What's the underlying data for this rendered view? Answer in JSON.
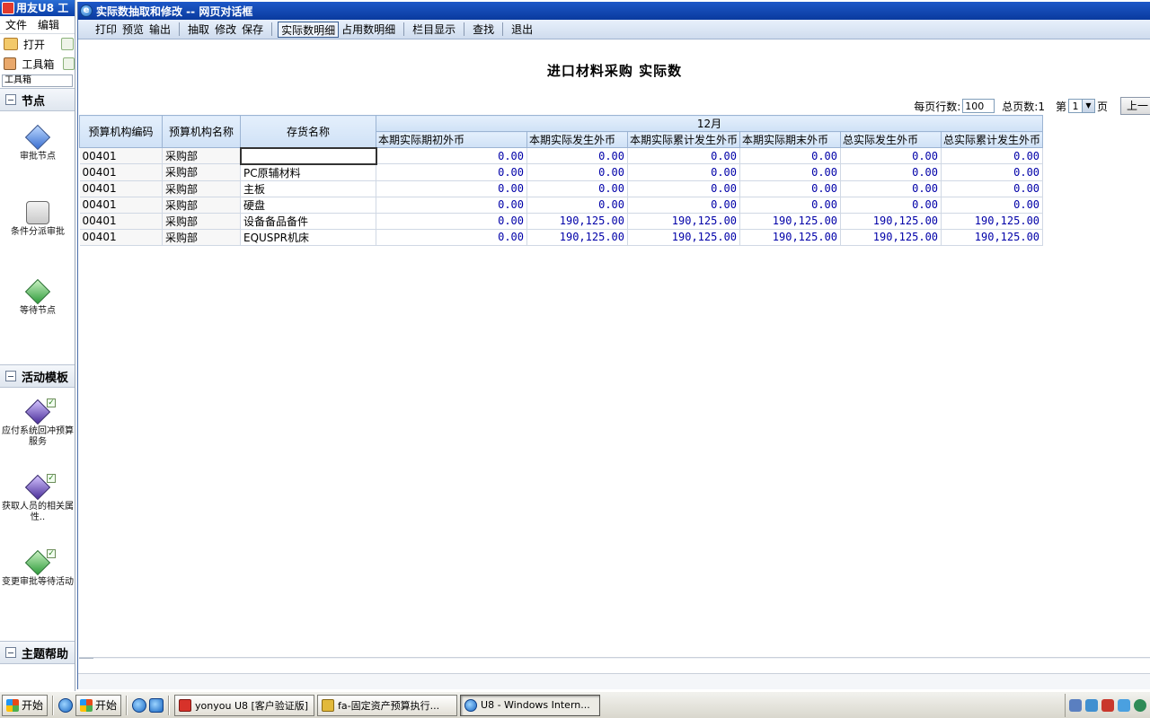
{
  "bg_app": {
    "title": "用友U8 工",
    "menu": [
      "文件",
      "编辑"
    ],
    "open_label": "打开",
    "toolbox_label": "工具箱",
    "toolbox_field": "工具箱",
    "section_nodes": "节点",
    "nodes": [
      "审批节点",
      "条件分派审批",
      "等待节点"
    ],
    "section_templates": "活动模板",
    "templates": [
      "应付系统回冲预算服务",
      "获取人员的相关属性..",
      "变更审批等待活动"
    ],
    "section_help": "主题帮助"
  },
  "dialog": {
    "title": "实际数抽取和修改  --  网页对话框",
    "toolbar": {
      "print": "打印",
      "preview": "预览",
      "output": "输出",
      "extract": "抽取",
      "modify": "修改",
      "save": "保存",
      "actual_detail": "实际数明细",
      "used_detail": "占用数明细",
      "column_display": "栏目显示",
      "find": "查找",
      "exit": "退出"
    }
  },
  "report": {
    "title": "进口材料采购  实际数",
    "pager": {
      "rows_label": "每页行数:",
      "rows_value": "100",
      "total_pages_label": "总页数:1",
      "page_prefix": "第",
      "page_value": "1",
      "page_suffix": "页",
      "prev": "上一"
    },
    "columns": {
      "org_code": "预算机构编码",
      "org_name": "预算机构名称",
      "inventory": "存货名称",
      "month": "12月",
      "c1": "本期实际期初外币",
      "c2": "本期实际发生外币",
      "c3": "本期实际累计发生外币",
      "c4": "本期实际期末外币",
      "c5": "总实际发生外币",
      "c6": "总实际累计发生外币"
    },
    "rows": [
      {
        "org_code": "00401",
        "org_name": "采购部",
        "inventory": "",
        "c1": "0.00",
        "c2": "0.00",
        "c3": "0.00",
        "c4": "0.00",
        "c5": "0.00",
        "c6": "0.00"
      },
      {
        "org_code": "00401",
        "org_name": "采购部",
        "inventory": "PC原辅材料",
        "c1": "0.00",
        "c2": "0.00",
        "c3": "0.00",
        "c4": "0.00",
        "c5": "0.00",
        "c6": "0.00"
      },
      {
        "org_code": "00401",
        "org_name": "采购部",
        "inventory": "主板",
        "c1": "0.00",
        "c2": "0.00",
        "c3": "0.00",
        "c4": "0.00",
        "c5": "0.00",
        "c6": "0.00"
      },
      {
        "org_code": "00401",
        "org_name": "采购部",
        "inventory": "硬盘",
        "c1": "0.00",
        "c2": "0.00",
        "c3": "0.00",
        "c4": "0.00",
        "c5": "0.00",
        "c6": "0.00"
      },
      {
        "org_code": "00401",
        "org_name": "采购部",
        "inventory": "设备备品备件",
        "c1": "0.00",
        "c2": "190,125.00",
        "c3": "190,125.00",
        "c4": "190,125.00",
        "c5": "190,125.00",
        "c6": "190,125.00"
      },
      {
        "org_code": "00401",
        "org_name": "采购部",
        "inventory": "EQUSPR机床",
        "c1": "0.00",
        "c2": "190,125.00",
        "c3": "190,125.00",
        "c4": "190,125.00",
        "c5": "190,125.00",
        "c6": "190,125.00"
      }
    ]
  },
  "taskbar": {
    "start1": "开始",
    "start2": "开始",
    "tasks": [
      "yonyou U8 [客户验证版]",
      "fa-固定资产预算执行...",
      "U8 - Windows Intern..."
    ]
  }
}
